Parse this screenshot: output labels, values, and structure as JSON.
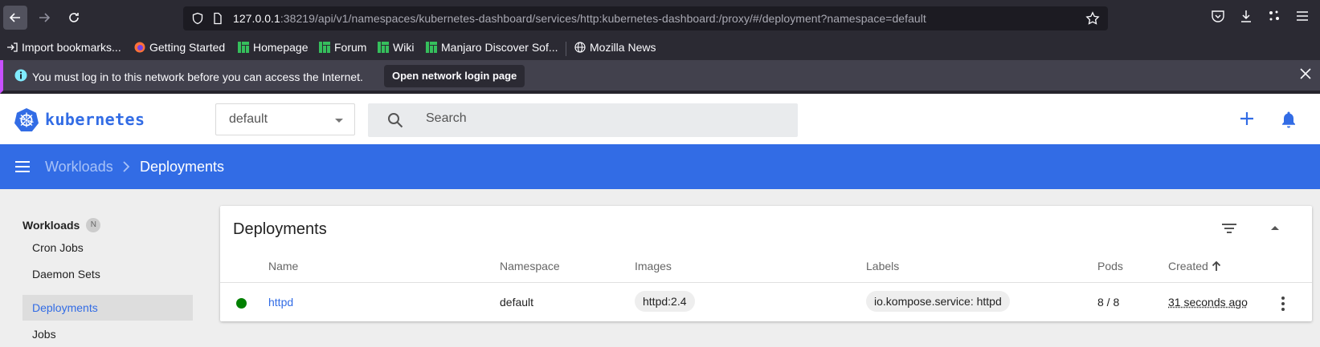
{
  "browser": {
    "url_host": "127.0.0.1",
    "url_rest": ":38219/api/v1/namespaces/kubernetes-dashboard/services/http:kubernetes-dashboard:/proxy/#/deployment?namespace=default",
    "bookmarks": [
      {
        "label": "Import bookmarks...",
        "icon": "import-icon"
      },
      {
        "label": "Getting Started",
        "icon": "firefox-icon"
      },
      {
        "label": "Homepage",
        "icon": "manjaro-icon"
      },
      {
        "label": "Forum",
        "icon": "manjaro-icon"
      },
      {
        "label": "Wiki",
        "icon": "manjaro-icon"
      },
      {
        "label": "Manjaro Discover Sof...",
        "icon": "manjaro-icon"
      },
      {
        "label": "Mozilla News",
        "icon": "globe-icon"
      }
    ]
  },
  "notice": {
    "text": "You must log in to this network before you can access the Internet.",
    "button": "Open network login page"
  },
  "header": {
    "logo_text": "kubernetes",
    "namespace": "default",
    "search_placeholder": "Search"
  },
  "breadcrumb": {
    "parent": "Workloads",
    "current": "Deployments"
  },
  "sidebar": {
    "heading": "Workloads",
    "badge": "N",
    "items": [
      "Cron Jobs",
      "Daemon Sets",
      "Deployments",
      "Jobs"
    ],
    "active": "Deployments"
  },
  "card": {
    "title": "Deployments",
    "columns": [
      "Name",
      "Namespace",
      "Images",
      "Labels",
      "Pods",
      "Created"
    ],
    "sort_icon": "arrow-up-icon",
    "rows": [
      {
        "status": "running",
        "name": "httpd",
        "namespace": "default",
        "image": "httpd:2.4",
        "label": "io.kompose.service: httpd",
        "pods": "8 / 8",
        "created": "31 seconds ago"
      }
    ]
  },
  "colors": {
    "k8s_blue": "#326ce5",
    "status_green": "#008000",
    "browser_bg": "#2b2a33"
  }
}
